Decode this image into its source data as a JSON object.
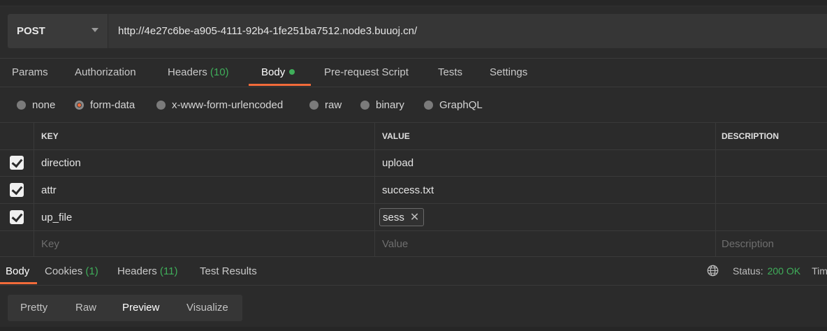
{
  "request": {
    "method": "POST",
    "url": "http://4e27c6be-a905-4111-92b4-1fe251ba7512.node3.buuoj.cn/"
  },
  "request_tabs": {
    "params": "Params",
    "authorization": "Authorization",
    "headers": "Headers",
    "headers_count": "(10)",
    "body": "Body",
    "prerequest": "Pre-request Script",
    "tests": "Tests",
    "settings": "Settings"
  },
  "body_modes": {
    "none": "none",
    "form_data": "form-data",
    "urlencoded": "x-www-form-urlencoded",
    "raw": "raw",
    "binary": "binary",
    "graphql": "GraphQL",
    "selected": "form-data"
  },
  "table": {
    "headers": {
      "key": "KEY",
      "value": "VALUE",
      "description": "DESCRIPTION"
    },
    "rows": [
      {
        "checked": true,
        "key": "direction",
        "value": "upload",
        "description": ""
      },
      {
        "checked": true,
        "key": "attr",
        "value": "success.txt",
        "description": ""
      },
      {
        "checked": true,
        "key": "up_file",
        "value": "sess",
        "description": ""
      }
    ],
    "placeholder": {
      "key": "Key",
      "value": "Value",
      "description": "Description"
    }
  },
  "response_tabs": {
    "body": "Body",
    "cookies": "Cookies",
    "cookies_count": "(1)",
    "headers": "Headers",
    "headers_count": "(11)",
    "test_results": "Test Results"
  },
  "status": {
    "label": "Status:",
    "value": "200 OK",
    "time_label": "Tim"
  },
  "view_modes": {
    "pretty": "Pretty",
    "raw": "Raw",
    "preview": "Preview",
    "visualize": "Visualize",
    "selected": "Preview"
  },
  "colors": {
    "accent": "#f26b3a",
    "green": "#3fae5a",
    "background": "#2b2b2b"
  }
}
